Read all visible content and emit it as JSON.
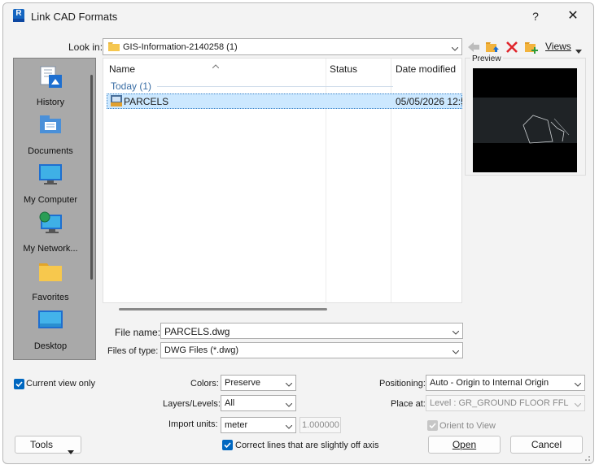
{
  "window": {
    "title": "Link CAD Formats",
    "help": "?",
    "close": "✕"
  },
  "look_in": {
    "label": "Look in:",
    "value": "GIS-Information-2140258 (1)"
  },
  "toolbar": {
    "views_label": "Views"
  },
  "sidebar": {
    "items": [
      {
        "label": "History",
        "icon": "history-icon"
      },
      {
        "label": "Documents",
        "icon": "documents-icon"
      },
      {
        "label": "My Computer",
        "icon": "computer-icon"
      },
      {
        "label": "My Network...",
        "icon": "network-icon"
      },
      {
        "label": "Favorites",
        "icon": "folder-icon"
      },
      {
        "label": "Desktop",
        "icon": "desktop-icon"
      }
    ]
  },
  "filelist": {
    "columns": [
      "Name",
      "Status",
      "Date modified"
    ],
    "group": "Today (1)",
    "rows": [
      {
        "name": "PARCELS",
        "status": "",
        "date": "05/05/2026 12:5"
      }
    ]
  },
  "preview": {
    "label": "Preview"
  },
  "file_name": {
    "label": "File name:",
    "value": "PARCELS.dwg"
  },
  "file_type": {
    "label": "Files of type:",
    "value": "DWG Files  (*.dwg)"
  },
  "options": {
    "current_view_only": "Current view only",
    "colors_label": "Colors:",
    "colors_value": "Preserve",
    "layers_label": "Layers/Levels:",
    "layers_value": "All",
    "units_label": "Import units:",
    "units_value": "meter",
    "units_factor": "1.000000",
    "correct_lines": "Correct lines that are slightly off axis",
    "positioning_label": "Positioning:",
    "positioning_value": "Auto - Origin to Internal Origin",
    "place_at_label": "Place at:",
    "place_at_value": "Level : GR_GROUND FLOOR FFL",
    "orient_to_view": "Orient to View"
  },
  "buttons": {
    "tools": "Tools",
    "open": "Open",
    "cancel": "Cancel"
  },
  "colors": {
    "accent": "#0067c0",
    "selection": "#cce8ff"
  }
}
